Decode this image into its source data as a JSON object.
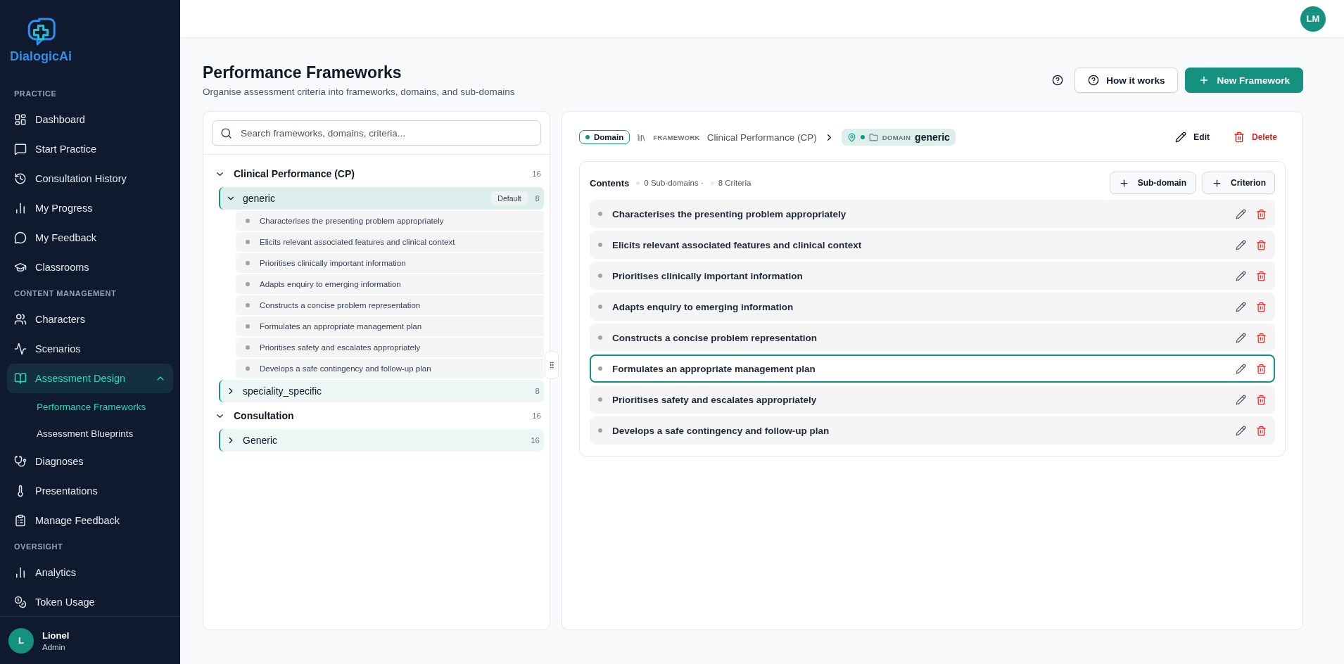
{
  "sidebar": {
    "logo": "DialogicAi",
    "sections": [
      {
        "title": "PRACTICE",
        "items": [
          {
            "label": "Dashboard",
            "selected": false
          },
          {
            "label": "Start Practice",
            "selected": false
          },
          {
            "label": "Consultation History",
            "selected": false
          },
          {
            "label": "My Progress",
            "selected": false
          },
          {
            "label": "My Feedback",
            "selected": false
          },
          {
            "label": "Classrooms",
            "selected": false
          }
        ]
      },
      {
        "title": "CONTENT MANAGEMENT",
        "items": [
          {
            "label": "Characters",
            "selected": false
          },
          {
            "label": "Scenarios",
            "selected": false
          },
          {
            "label": "Assessment Design",
            "selected": true,
            "expanded": true,
            "children": [
              {
                "label": "Performance Frameworks",
                "selected": true
              },
              {
                "label": "Assessment Blueprints",
                "selected": false
              }
            ]
          },
          {
            "label": "Diagnoses",
            "selected": false
          },
          {
            "label": "Presentations",
            "selected": false
          },
          {
            "label": "Manage Feedback",
            "selected": false
          }
        ]
      },
      {
        "title": "OVERSIGHT",
        "items": [
          {
            "label": "Analytics",
            "selected": false
          },
          {
            "label": "Token Usage",
            "selected": false
          }
        ]
      }
    ],
    "user": {
      "initial": "L",
      "name": "Lionel",
      "role": "Admin"
    }
  },
  "topbar": {
    "avatar": "LM"
  },
  "header": {
    "title": "Performance Frameworks",
    "subtitle": "Organise assessment criteria into frameworks, domains, and sub-domains",
    "how_button": "How it works",
    "new_button": "New Framework"
  },
  "tree": {
    "search_placeholder": "Search frameworks, domains, criteria...",
    "frameworks": [
      {
        "name": "Clinical Performance (CP)",
        "count": "16",
        "expanded": true,
        "domains": [
          {
            "name": "generic",
            "badge": "Default",
            "count": "8",
            "expanded": true,
            "selected": true,
            "criteria": [
              "Characterises the presenting problem appropriately",
              "Elicits relevant associated features and clinical context",
              "Prioritises clinically important information",
              "Adapts enquiry to emerging information",
              "Constructs a concise problem representation",
              "Formulates an appropriate management plan",
              "Prioritises safety and escalates appropriately",
              "Develops a safe contingency and follow-up plan"
            ]
          },
          {
            "name": "speciality_specific",
            "count": "8",
            "expanded": false,
            "selected": false
          }
        ]
      },
      {
        "name": "Consultation",
        "count": "16",
        "expanded": true,
        "domains": [
          {
            "name": "Generic",
            "count": "16",
            "expanded": false,
            "selected": false
          }
        ]
      }
    ]
  },
  "detail": {
    "type_badge": "Domain",
    "breadcrumb": {
      "framework_label": "FRAMEWORK",
      "framework": "Clinical Performance (CP)",
      "domain_label": "DOMAIN",
      "domain": "generic"
    },
    "edit": "Edit",
    "delete": "Delete",
    "contents": {
      "title": "Contents",
      "subdomains": "0 Sub-domains ·",
      "criteria_count": "8 Criteria",
      "add_subdomain": "Sub-domain",
      "add_criterion": "Criterion",
      "criteria": [
        {
          "text": "Characterises the presenting problem appropriately",
          "selected": false
        },
        {
          "text": "Elicits relevant associated features and clinical context",
          "selected": false
        },
        {
          "text": "Prioritises clinically important information",
          "selected": false
        },
        {
          "text": "Adapts enquiry to emerging information",
          "selected": false
        },
        {
          "text": "Constructs a concise problem representation",
          "selected": false
        },
        {
          "text": "Formulates an appropriate management plan",
          "selected": true
        },
        {
          "text": "Prioritises safety and escalates appropriately",
          "selected": false
        },
        {
          "text": "Develops a safe contingency and follow-up plan",
          "selected": false
        }
      ]
    }
  }
}
